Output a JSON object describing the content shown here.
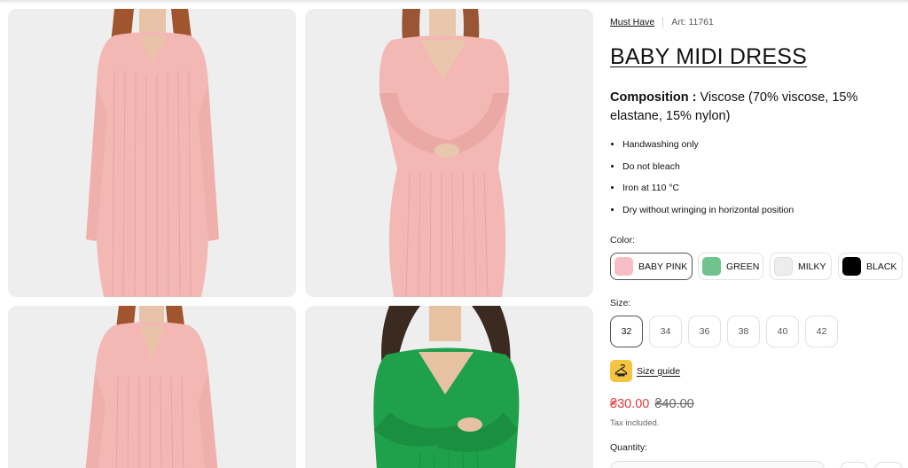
{
  "product": {
    "brand": "Must Have",
    "sku": "Art: 11761",
    "title": "BABY MIDI DRESS",
    "composition_label": "Composition :",
    "composition_value": "Viscose (70% viscose, 15% elastane, 15% nylon)",
    "care": [
      "Handwashing only",
      "Do not bleach",
      "Iron at 110 °C",
      "Dry without wringing in horizontal position"
    ]
  },
  "color": {
    "label": "Color:",
    "options": [
      {
        "name": "BABY PINK",
        "hex": "#f7bfc5",
        "selected": true
      },
      {
        "name": "GREEN",
        "hex": "#6fc38c",
        "selected": false
      },
      {
        "name": "MILKY",
        "hex": "#ededed",
        "selected": false
      },
      {
        "name": "BLACK",
        "hex": "#000000",
        "selected": false
      }
    ]
  },
  "size": {
    "label": "Size:",
    "options": [
      "32",
      "34",
      "36",
      "38",
      "40",
      "42"
    ],
    "selected": "32",
    "guide_label": "Size guide",
    "guide_icon": "hanger-icon"
  },
  "price": {
    "current": "₴30.00",
    "original": "₴40.00",
    "sale_color": "#e23a3a",
    "tax_note": "Tax included."
  },
  "quantity": {
    "label": "Quantity:"
  },
  "gallery": {
    "photos": [
      "baby-pink-dress-front",
      "baby-pink-dress-crossed-arms",
      "baby-pink-dress-detail",
      "green-dress-crossed-arms"
    ]
  }
}
